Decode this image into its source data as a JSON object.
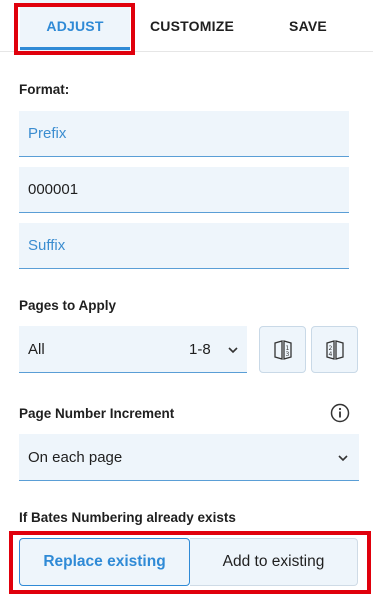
{
  "tabs": [
    {
      "label": "ADJUST"
    },
    {
      "label": "CUSTOMIZE"
    },
    {
      "label": "SAVE"
    }
  ],
  "format": {
    "label": "Format:",
    "prefix_placeholder": "Prefix",
    "number_value": "000001",
    "suffix_placeholder": "Suffix"
  },
  "pages_to_apply": {
    "label": "Pages to Apply",
    "selected": "All",
    "range": "1-8",
    "buttons": [
      {
        "icon": "odd-pages-icon"
      },
      {
        "icon": "even-pages-icon"
      }
    ]
  },
  "page_number_increment": {
    "label": "Page Number Increment",
    "selected": "On each page",
    "info_icon": "info-icon"
  },
  "bates_exists": {
    "label": "If Bates Numbering already exists",
    "options": [
      {
        "label": "Replace existing"
      },
      {
        "label": "Add to existing"
      }
    ]
  },
  "colors": {
    "accent": "#2f8ad6",
    "field_bg": "#eef5fb",
    "highlight": "#e0000c"
  }
}
